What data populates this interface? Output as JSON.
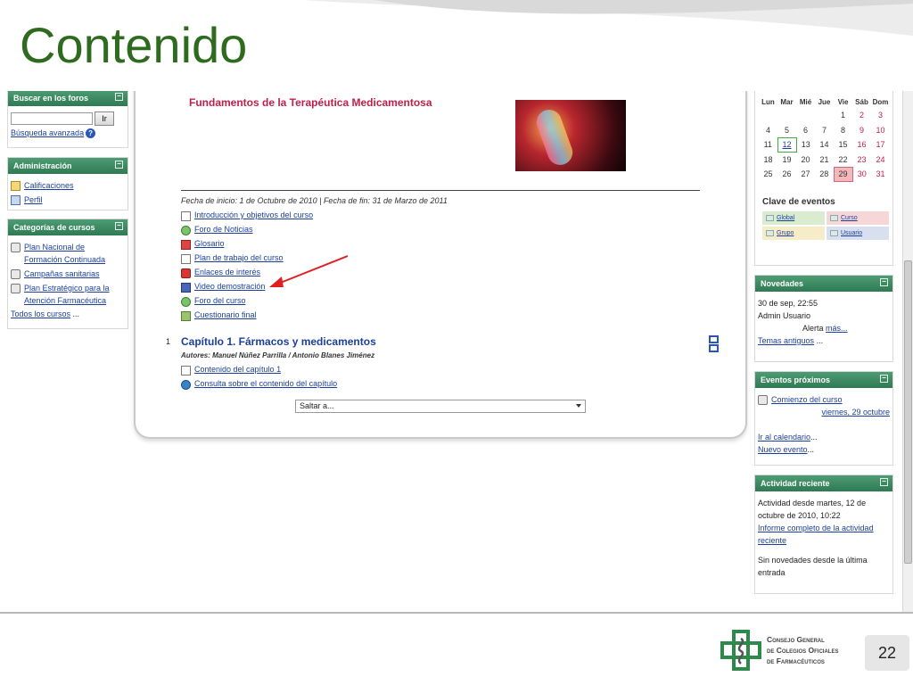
{
  "slide": {
    "title": "Contenido",
    "page_number": "22"
  },
  "sidebar": {
    "search": {
      "header": "Buscar en los foros",
      "button": "Ir",
      "advanced": "Búsqueda avanzada",
      "help_glyph": "?"
    },
    "admin": {
      "header": "Administración",
      "items": [
        "Calificaciones",
        "Perfil"
      ]
    },
    "categories": {
      "header": "Categorías de cursos",
      "items": [
        "Plan Nacional de Formación Continuada",
        "Campañas sanitarias",
        "Plan Estratégico para la Atención Farmacéutica"
      ],
      "all_link": "Todos los cursos",
      "ellipsis": "..."
    },
    "minimize_glyph": "−"
  },
  "course": {
    "title": "Fundamentos de la Terapéutica Medicamentosa",
    "dates": "Fecha de inicio: 1 de Octubre de 2010 | Fecha de fin: 31 de Marzo de 2011",
    "topics": [
      {
        "label": "Introducción y objetivos del curso",
        "icon": "page-icon"
      },
      {
        "label": "Foro de Noticias",
        "icon": "forum-icon"
      },
      {
        "label": "Glosario",
        "icon": "glossary-icon"
      },
      {
        "label": "Plan de trabajo del curso",
        "icon": "document-icon"
      },
      {
        "label": "Enlaces de interés",
        "icon": "link-icon"
      },
      {
        "label": "Video demostración",
        "icon": "video-icon"
      },
      {
        "label": "Foro del curso",
        "icon": "forum-icon"
      },
      {
        "label": "Cuestionario final",
        "icon": "quiz-icon"
      }
    ],
    "chapter": {
      "number": "1",
      "title": "Capítulo 1. Fármacos y medicamentos",
      "authors": "Autores: Manuel Núñez Parrilla / Antonio Blanes Jiménez",
      "items": [
        {
          "label": "Contenido del capítulo 1",
          "icon": "document-icon"
        },
        {
          "label": "Consulta sobre el contenido del capítulo",
          "icon": "chat-icon"
        }
      ]
    },
    "jump_select": "Saltar a..."
  },
  "calendar": {
    "weekdays": [
      "Lun",
      "Mar",
      "Mié",
      "Jue",
      "Vie",
      "Sáb",
      "Dom"
    ],
    "weeks": [
      [
        "",
        "",
        "",
        "",
        "1",
        "2",
        "3"
      ],
      [
        "4",
        "5",
        "6",
        "7",
        "8",
        "9",
        "10"
      ],
      [
        "11",
        "12",
        "13",
        "14",
        "15",
        "16",
        "17"
      ],
      [
        "18",
        "19",
        "20",
        "21",
        "22",
        "23",
        "24"
      ],
      [
        "25",
        "26",
        "27",
        "28",
        "29",
        "30",
        "31"
      ]
    ],
    "today": "12",
    "event_day": "29",
    "legend_title": "Clave de eventos",
    "legend": [
      {
        "label": "Global",
        "color": "#d9ecd0"
      },
      {
        "label": "Curso",
        "color": "#f6d6d6"
      },
      {
        "label": "Grupo",
        "color": "#f6ecc8"
      },
      {
        "label": "Usuario",
        "color": "#d8e0ef"
      }
    ]
  },
  "news": {
    "header": "Novedades",
    "date": "30 de sep, 22:55",
    "author": "Admin Usuario",
    "alert": "Alerta",
    "more": "más...",
    "old_topics": "Temas antiguos",
    "ellipsis": "..."
  },
  "upcoming": {
    "header": "Eventos próximos",
    "event": "Comienzo del curso",
    "event_date": "viernes, 29 octubre",
    "go_calendar": "Ir al calendario",
    "new_event": "Nuevo evento",
    "ellipsis": "..."
  },
  "recent": {
    "header": "Actividad reciente",
    "since": "Actividad desde martes, 12 de octubre de 2010, 10:22",
    "full_report": "Informe completo de la actividad reciente",
    "no_news": "Sin novedades desde la última entrada"
  },
  "footer": {
    "org_lines": [
      "Consejo General",
      "de Colegios Oficiales",
      "de Farmacéuticos"
    ]
  },
  "colors": {
    "title_green": "#2e6b1e",
    "block_header": "#2e7a53",
    "link_blue": "#1c3f9c",
    "course_title_red": "#c21e4a",
    "annotation_arrow": "#e02020"
  }
}
